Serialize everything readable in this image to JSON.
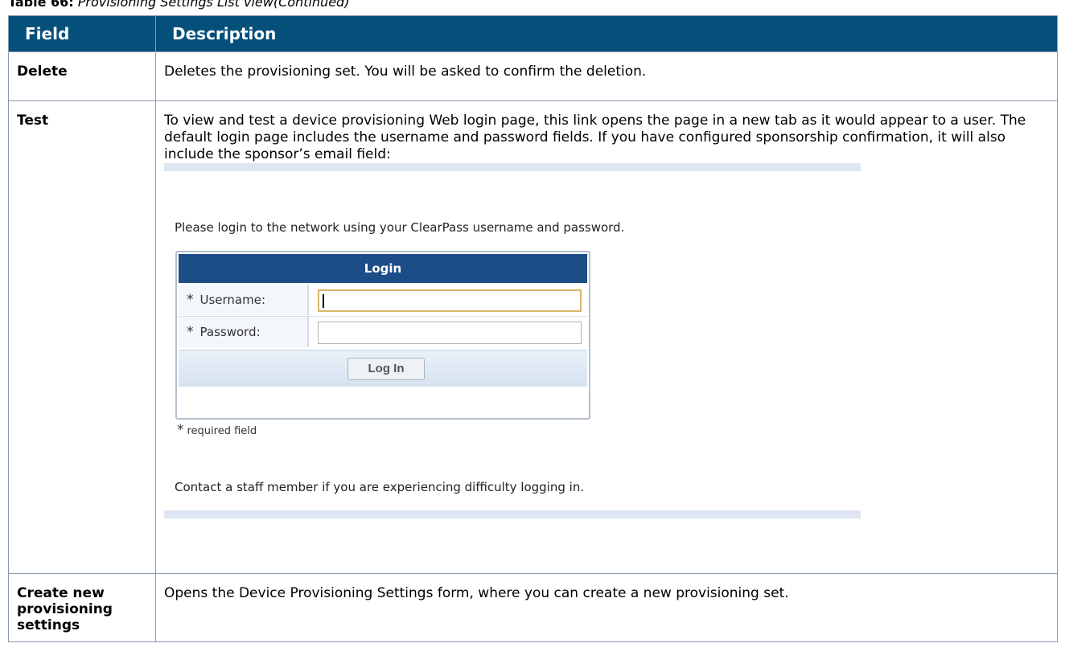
{
  "caption": {
    "label": "Table 66:",
    "title": "Provisioning Settings List view(Continued)"
  },
  "table": {
    "headers": [
      "Field",
      "Description"
    ],
    "rows": [
      {
        "field": "Delete",
        "description": "Deletes the provisioning set. You will be asked to confirm the deletion."
      },
      {
        "field": "Test",
        "description": "To view and test a device provisioning Web login page, this link opens the page in a new tab as it would appear to a user. The default login page includes the username and password fields. If you have configured sponsorship confirmation, it will also include the sponsor’s email field:"
      },
      {
        "field": "Create new provisioning settings",
        "description": "Opens the Device Provisioning Settings form, where you can create a new provisioning set."
      }
    ]
  },
  "login_screenshot": {
    "intro": "Please login to the network using your ClearPass username and password.",
    "box_title": "Login",
    "required_marker": "*",
    "username_label": "Username:",
    "password_label": "Password:",
    "button_label": "Log In",
    "required_note": "required field",
    "contact_text": "Contact a staff member if you are experiencing difficulty logging in."
  }
}
